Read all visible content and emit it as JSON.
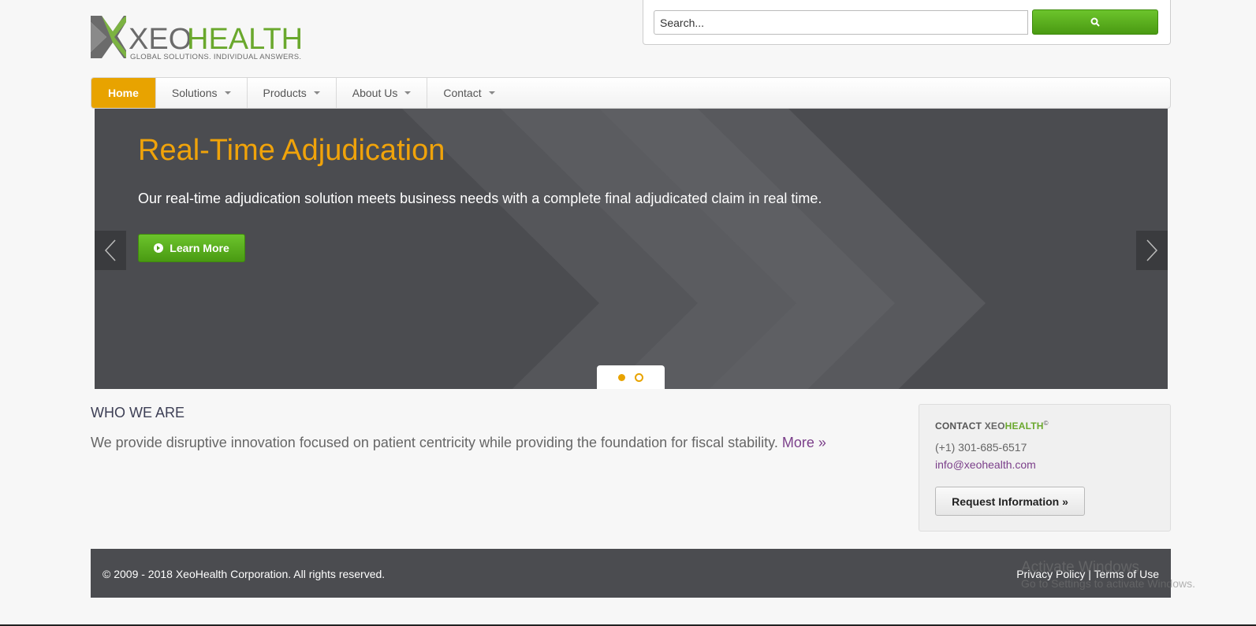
{
  "header": {
    "logo_main_a": "XEO",
    "logo_main_b": "HEALTH",
    "logo_tagline": "GLOBAL SOLUTIONS. INDIVIDUAL ANSWERS.",
    "search_placeholder": "Search...",
    "search_icon": "search-icon"
  },
  "nav": {
    "items": [
      {
        "label": "Home",
        "active": true
      },
      {
        "label": "Solutions",
        "dropdown": true
      },
      {
        "label": "Products",
        "dropdown": true
      },
      {
        "label": "About Us",
        "dropdown": true
      },
      {
        "label": "Contact",
        "dropdown": true
      }
    ]
  },
  "carousel": {
    "title": "Real-Time Adjudication",
    "text": "Our real-time adjudication solution meets business needs with a complete final adjudicated claim in real time.",
    "button_label": "Learn More",
    "button_icon": "arrow-circle-right-icon",
    "prev_icon": "chevron-left-icon",
    "next_icon": "chevron-right-icon",
    "slide_count": 2,
    "active_slide": 1
  },
  "who": {
    "heading": "WHO WE ARE",
    "text": "We provide disruptive innovation focused on patient centricity while providing the foundation for fiscal stability.",
    "more_label": "More »"
  },
  "contact": {
    "title_prefix": "CONTACT ",
    "title_brand_a": "XEO",
    "title_brand_b": "HEALTH",
    "title_mark": "©",
    "phone": "(+1) 301-685-6517",
    "email": "info@xeohealth.com",
    "request_label": "Request Information »"
  },
  "footer": {
    "copyright": "© 2009 - 2018 XeoHealth Corporation. All rights reserved.",
    "privacy_label": "Privacy Policy",
    "separator": "|",
    "terms_label": "Terms of Use"
  },
  "watermark": {
    "line1": "Activate Windows",
    "line2": "Go to Settings to activate Windows."
  },
  "colors": {
    "accent_orange": "#e8a300",
    "brand_green": "#6aa82d",
    "button_green": "#5aaf1c",
    "dark_panel": "#4b4c50",
    "link_purple": "#7b3f8a"
  }
}
